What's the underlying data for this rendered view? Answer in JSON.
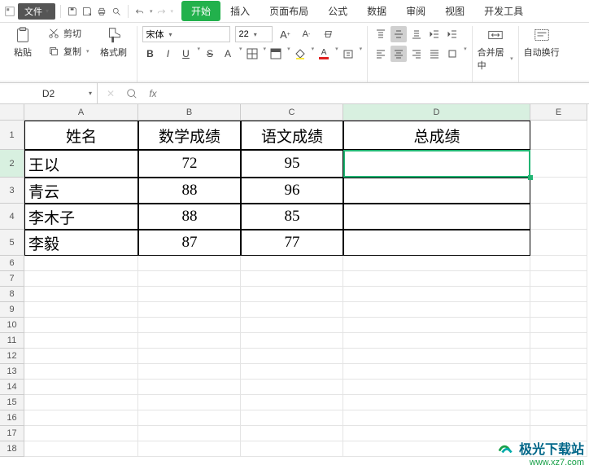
{
  "titlebar": {
    "menu_label": "文件"
  },
  "tabs": {
    "items": [
      "开始",
      "插入",
      "页面布局",
      "公式",
      "数据",
      "审阅",
      "视图",
      "开发工具"
    ],
    "active_index": 0
  },
  "ribbon": {
    "paste": "粘贴",
    "cut": "剪切",
    "copy": "复制",
    "format_painter": "格式刷",
    "font_name": "宋体",
    "font_size": "22",
    "merge_center": "合并居中",
    "auto_wrap": "自动换行"
  },
  "fbar": {
    "namebox": "D2",
    "fx_label": "fx",
    "formula": ""
  },
  "grid": {
    "cols": [
      "A",
      "B",
      "C",
      "D",
      "E"
    ],
    "active_col": "D",
    "active_row": 2,
    "headers": [
      "姓名",
      "数学成绩",
      "语文成绩",
      "总成绩"
    ],
    "rows": [
      {
        "name": "王以",
        "math": "72",
        "chinese": "95",
        "total": ""
      },
      {
        "name": "青云",
        "math": "88",
        "chinese": "96",
        "total": ""
      },
      {
        "name": "李木子",
        "math": "88",
        "chinese": "85",
        "total": ""
      },
      {
        "name": "李毅",
        "math": "87",
        "chinese": "77",
        "total": ""
      }
    ],
    "blank_rows": [
      6,
      7,
      8,
      9,
      10,
      11,
      12,
      13,
      14,
      15,
      16,
      17,
      18
    ]
  },
  "watermark": {
    "line1": "极光下载站",
    "line2": "www.xz7.com"
  },
  "colors": {
    "accent": "#22b14c",
    "selection": "#22b573"
  }
}
